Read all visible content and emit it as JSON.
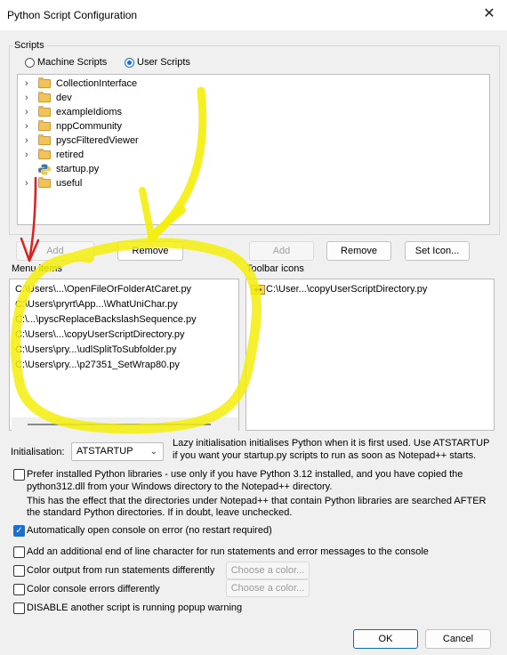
{
  "window": {
    "title": "Python Script Configuration",
    "close_icon": "close-icon"
  },
  "scripts_group": {
    "label": "Scripts",
    "radio_machine": "Machine Scripts",
    "radio_user": "User Scripts",
    "selected": "User Scripts",
    "tree": [
      {
        "label": "CollectionInterface",
        "icon": "folder-icon"
      },
      {
        "label": "dev",
        "icon": "folder-icon"
      },
      {
        "label": "exampleIdioms",
        "icon": "folder-icon"
      },
      {
        "label": "nppCommunity",
        "icon": "folder-icon"
      },
      {
        "label": "pyscFilteredViewer",
        "icon": "folder-icon"
      },
      {
        "label": "retired",
        "icon": "folder-icon"
      },
      {
        "label": "startup.py",
        "icon": "python-file-icon"
      },
      {
        "label": "useful",
        "icon": "folder-icon"
      }
    ]
  },
  "buttons": {
    "add": "Add",
    "remove": "Remove",
    "set_icon": "Set Icon..."
  },
  "menu_items": {
    "label": "Menu items",
    "items": [
      "C:\\Users\\...\\OpenFileOrFolderAtCaret.py",
      "C:\\Users\\pryrt\\App...\\WhatUniChar.py",
      "C:\\...\\pyscReplaceBackslashSequence.py",
      "C:\\Users\\...\\copyUserScriptDirectory.py",
      "C:\\Users\\pry...\\udlSplitToSubfolder.py",
      "C:\\Users\\pry...\\p27351_SetWrap80.py"
    ]
  },
  "toolbar_icons": {
    "label": "Toolbar icons",
    "items": [
      "C:\\User...\\copyUserScriptDirectory.py"
    ]
  },
  "initialisation": {
    "label": "Initialisation:",
    "value": "ATSTARTUP",
    "help_line1": "Lazy initialisation initialises Python when it is first used.  Use ATSTARTUP",
    "help_line2": "if you want your startup.py scripts to run as soon as Notepad++ starts."
  },
  "options": {
    "prefer_line1": "Prefer installed Python libraries - use only if you have Python 3.12 installed, and you have copied the",
    "prefer_line2": "python312.dll from your Windows directory to the Notepad++ directory.",
    "prefer_note1": "This has the effect that the directories under Notepad++ that contain Python libraries are searched AFTER",
    "prefer_note2": "the standard Python directories.  If in doubt, leave unchecked.",
    "auto_console": "Automatically open console on error (no restart required)",
    "add_eol": "Add an additional end of line character for run statements and error messages to the console",
    "color_output": "Color output from run statements differently",
    "color_errors": "Color console errors differently",
    "choose_color": "Choose a color...",
    "disable_popup": "DISABLE another script is running popup warning"
  },
  "footer": {
    "ok": "OK",
    "cancel": "Cancel"
  },
  "colors": {
    "accent": "#1a6fd1",
    "annotation_yellow": "#f4ee0c",
    "annotation_red": "#e02020"
  }
}
